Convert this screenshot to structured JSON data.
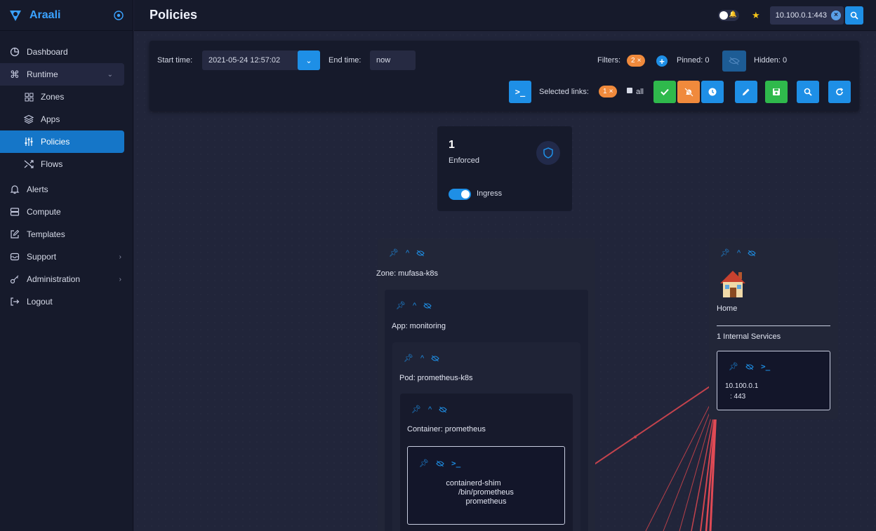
{
  "app": {
    "brand": "Araali",
    "page_title": "Policies"
  },
  "sidebar": {
    "items": [
      {
        "label": "Dashboard"
      },
      {
        "label": "Runtime"
      },
      {
        "label": "Zones"
      },
      {
        "label": "Apps"
      },
      {
        "label": "Policies"
      },
      {
        "label": "Flows"
      },
      {
        "label": "Alerts"
      },
      {
        "label": "Compute"
      },
      {
        "label": "Templates"
      },
      {
        "label": "Support"
      },
      {
        "label": "Administration"
      },
      {
        "label": "Logout"
      }
    ]
  },
  "header": {
    "search_value": "10.100.0.1:443"
  },
  "toolbar": {
    "start_label": "Start time:",
    "start_value": "2021-05-24 12:57:02",
    "end_label": "End time:",
    "end_value": "now",
    "filters_label": "Filters:",
    "filters_count": "2",
    "pinned_label": "Pinned: 0",
    "hidden_label": "Hidden: 0",
    "selected_links_label": "Selected links:",
    "selected_links_count": "1",
    "all_label": "all"
  },
  "enforced_card": {
    "count": "1",
    "label": "Enforced",
    "toggle_label": "Ingress"
  },
  "graph": {
    "zone_label": "Zone: mufasa-k8s",
    "app_label": "App: monitoring",
    "pod_label": "Pod: prometheus-k8s",
    "container_label": "Container: prometheus",
    "process_lines": [
      "containerd-shim",
      "/bin/prometheus",
      "prometheus"
    ],
    "home_label": "Home",
    "internal_services_label": "1 Internal Services",
    "service_ip": "10.100.0.1",
    "service_port": ": 443"
  },
  "colors": {
    "accent": "#1e8fe6",
    "link": "#e0424c",
    "pill": "#f08a3c",
    "ok": "#2fb94c"
  }
}
